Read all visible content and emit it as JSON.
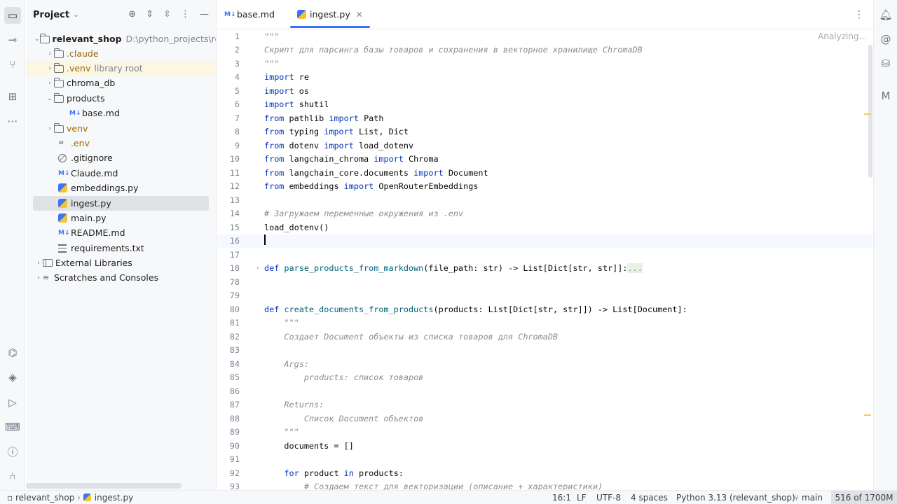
{
  "project_panel": {
    "title": "Project",
    "tree": [
      {
        "label": "relevant_shop",
        "path": "D:\\python_projects\\releva"
      },
      {
        "label": ".claude"
      },
      {
        "label": ".venv",
        "hint": "library root"
      },
      {
        "label": "chroma_db"
      },
      {
        "label": "products"
      },
      {
        "label": "base.md"
      },
      {
        "label": "venv"
      },
      {
        "label": ".env"
      },
      {
        "label": ".gitignore"
      },
      {
        "label": "Claude.md"
      },
      {
        "label": "embeddings.py"
      },
      {
        "label": "ingest.py"
      },
      {
        "label": "main.py"
      },
      {
        "label": "README.md"
      },
      {
        "label": "requirements.txt"
      },
      {
        "label": "External Libraries"
      },
      {
        "label": "Scratches and Consoles"
      }
    ]
  },
  "tabs": [
    {
      "label": "base.md",
      "icon": "markdown-icon"
    },
    {
      "label": "ingest.py",
      "icon": "python-icon",
      "active": true
    }
  ],
  "editor": {
    "status": "Analyzing...",
    "line_numbers": [
      "1",
      "2",
      "3",
      "4",
      "5",
      "6",
      "7",
      "8",
      "9",
      "10",
      "11",
      "12",
      "13",
      "14",
      "15",
      "16",
      "17",
      "18",
      "78",
      "79",
      "80",
      "81",
      "82",
      "83",
      "84",
      "85",
      "86",
      "87",
      "88",
      "89",
      "90",
      "91",
      "92",
      "93"
    ],
    "code": {
      "l1": "\"\"\"",
      "l2": "Скрипт для парсинга базы товаров и сохранения в векторное хранилище ChromaDB",
      "l3": "\"\"\"",
      "l4_kw": "import",
      "l4_rest": " re",
      "l5_kw": "import",
      "l5_rest": " os",
      "l6_kw": "import",
      "l6_rest": " shutil",
      "l7_kw1": "from",
      "l7_mod": " pathlib ",
      "l7_kw2": "import",
      "l7_rest": " Path",
      "l8_kw1": "from",
      "l8_mod": " typing ",
      "l8_kw2": "import",
      "l8_rest": " List, Dict",
      "l9_kw1": "from",
      "l9_mod": " dotenv ",
      "l9_kw2": "import",
      "l9_rest": " load_dotenv",
      "l10_kw1": "from",
      "l10_mod": " langchain_chroma ",
      "l10_kw2": "import",
      "l10_rest": " Chroma",
      "l11_kw1": "from",
      "l11_mod": " langchain_core.documents ",
      "l11_kw2": "import",
      "l11_rest": " Document",
      "l12_kw1": "from",
      "l12_mod": " embeddings ",
      "l12_kw2": "import",
      "l12_rest": " OpenRouterEmbeddings",
      "l14": "# Загружаем переменные окружения из .env",
      "l15": "load_dotenv()",
      "l18_kw": "def",
      "l18_fn": " parse_products_from_markdown",
      "l18_rest": "(file_path: str) -> List[Dict[str, str]]:",
      "l18_fold": "...",
      "l80_kw": "def",
      "l80_fn": " create_documents_from_products",
      "l80_rest": "(products: List[Dict[str, str]]) -> List[Document]:",
      "l81": "    \"\"\"",
      "l82": "    Создает Document объекты из списка товаров для ChromaDB",
      "l84": "    Args:",
      "l85": "        products: список товаров",
      "l87": "    Returns:",
      "l88": "        Список Document объектов",
      "l89": "    \"\"\"",
      "l90": "    documents = []",
      "l92_indent": "    ",
      "l92_kw1": "for",
      "l92_mid": " product ",
      "l92_kw2": "in",
      "l92_rest": " products:",
      "l93": "        # Создаем текст для векторизации (описание + характеристики)"
    }
  },
  "statusbar": {
    "breadcrumb_project": "relevant_shop",
    "breadcrumb_file": "ingest.py",
    "position": "16:1",
    "line_sep": "LF",
    "encoding": "UTF-8",
    "indent": "4 spaces",
    "interpreter": "Python 3.13 (relevant_shop)",
    "branch": "main",
    "memory": "516 of 1700M"
  },
  "colors": {
    "accent": "#3574f0",
    "keyword": "#0033b3",
    "function": "#00627a",
    "comment": "#8c8c8c"
  }
}
